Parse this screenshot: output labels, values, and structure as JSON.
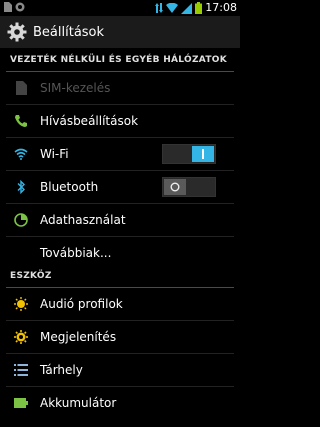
{
  "status_bar": {
    "time": "17:08",
    "icons": [
      "sim-icon",
      "notification-icon",
      "data-arrows-icon",
      "wifi-signal-icon",
      "cell-signal-icon",
      "battery-icon"
    ]
  },
  "action_bar": {
    "title": "Beállítások",
    "icon": "gear-icon"
  },
  "sections": [
    {
      "header": "VEZETÉK NÉLKÜLI ÉS EGYÉB HÁLÓZATOK",
      "items": [
        {
          "label": "SIM-kezelés",
          "icon": "sim-icon",
          "enabled": false
        },
        {
          "label": "Hívásbeállítások",
          "icon": "phone-icon",
          "enabled": true
        },
        {
          "label": "Wi-Fi",
          "icon": "wifi-icon",
          "toggle": "on"
        },
        {
          "label": "Bluetooth",
          "icon": "bluetooth-icon",
          "toggle": "off"
        },
        {
          "label": "Adathasználat",
          "icon": "data-usage-icon",
          "enabled": true
        },
        {
          "label": "Továbbiak...",
          "icon": "",
          "enabled": true
        }
      ]
    },
    {
      "header": "ESZKÖZ",
      "items": [
        {
          "label": "Audió profilok",
          "icon": "audio-profiles-icon",
          "enabled": true
        },
        {
          "label": "Megjelenítés",
          "icon": "display-icon",
          "enabled": true
        },
        {
          "label": "Tárhely",
          "icon": "storage-icon",
          "enabled": true
        },
        {
          "label": "Akkumulátor",
          "icon": "battery-icon",
          "enabled": true
        }
      ]
    }
  ],
  "colors": {
    "accent": "#33b5e5",
    "background": "#000000",
    "action_bar": "#1b1b1b",
    "phone_icon": "#7cc244",
    "data_usage_icon": "#7cc244",
    "audio_icon": "#f2c200",
    "display_icon": "#f2c200",
    "storage_icon": "#8fb4d9",
    "battery_icon": "#7cc244"
  }
}
